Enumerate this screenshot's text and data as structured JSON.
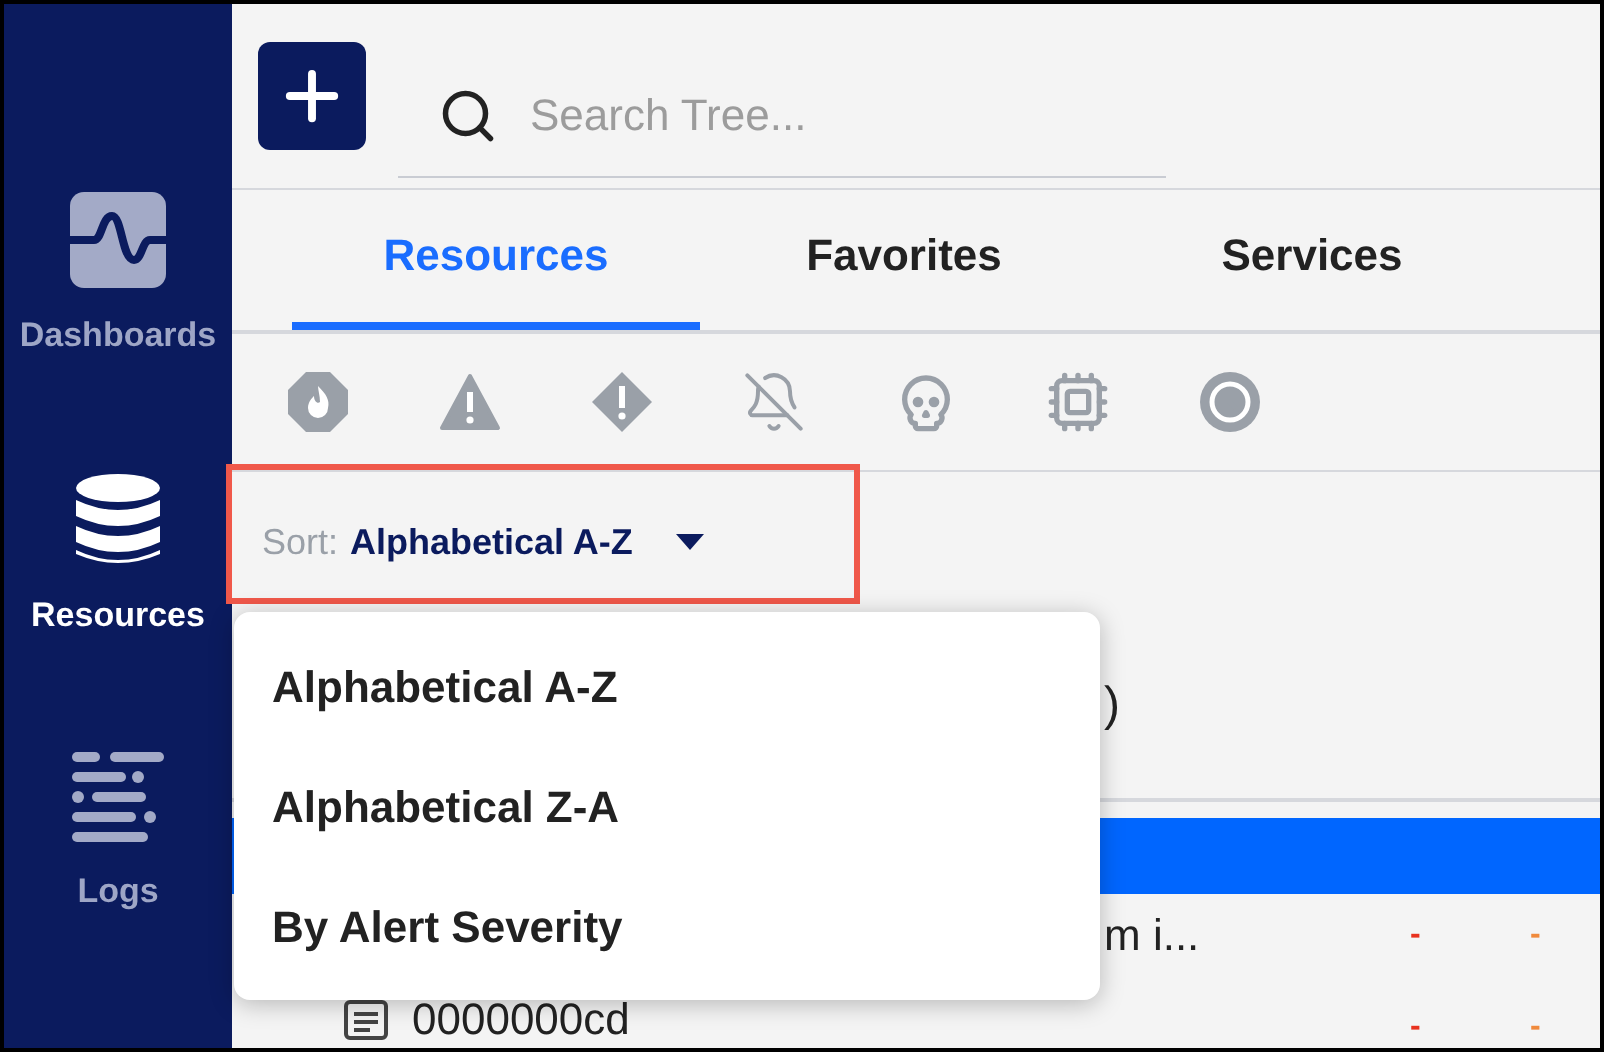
{
  "sidebar": {
    "items": [
      {
        "kind": "dashboards",
        "label": "Dashboards",
        "selected": false
      },
      {
        "kind": "resources",
        "label": "Resources",
        "selected": true
      },
      {
        "kind": "logs",
        "label": "Logs",
        "selected": false
      }
    ]
  },
  "search": {
    "placeholder": "Search Tree..."
  },
  "tabs": [
    {
      "label": "Resources",
      "selected": true
    },
    {
      "label": "Favorites",
      "selected": false
    },
    {
      "label": "Services",
      "selected": false
    }
  ],
  "filters": [
    {
      "kind": "critical"
    },
    {
      "kind": "error"
    },
    {
      "kind": "warning"
    },
    {
      "kind": "muted"
    },
    {
      "kind": "dead"
    },
    {
      "kind": "unknown"
    },
    {
      "kind": "delayed"
    }
  ],
  "sort": {
    "label": "Sort:",
    "value": "Alphabetical A-Z"
  },
  "sort_menu": {
    "options": [
      "Alphabetical A-Z",
      "Alphabetical Z-A",
      "By Alert Severity"
    ]
  },
  "tree_rows": [
    {
      "kind": "plain",
      "text": ")",
      "selected": false
    },
    {
      "kind": "empty",
      "selected": true
    },
    {
      "kind": "plain",
      "text": "m i...",
      "status_1": "-",
      "status_2": "-",
      "selected": false
    },
    {
      "kind": "doc",
      "text": "0000000cd",
      "status_1": "-",
      "status_2": "-",
      "selected": false
    }
  ]
}
